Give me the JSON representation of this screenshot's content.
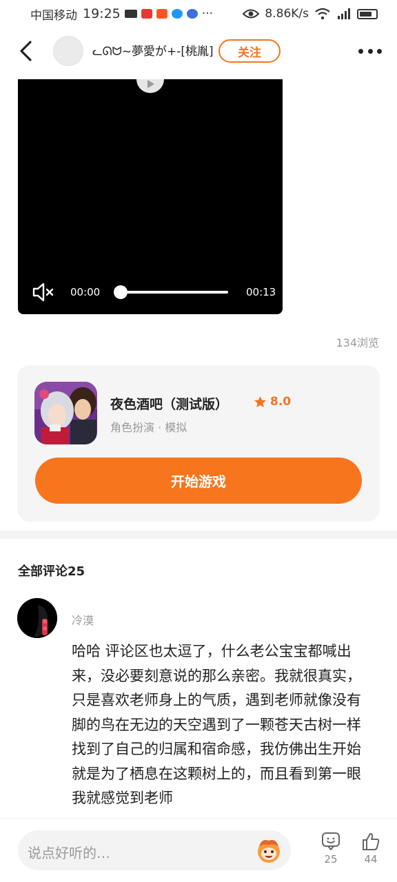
{
  "status_bar": {
    "carrier": "中国移动",
    "time": "19:25",
    "more_indicator": "···",
    "network_speed": "8.86K/s",
    "battery_level_percent": 75
  },
  "header": {
    "author_name": "ᓚᘏᗢ~夢愛が+-[桃胤]",
    "follow_label": "关注"
  },
  "video": {
    "current_time": "00:00",
    "duration": "00:13",
    "progress_percent": 0
  },
  "views_text": "134浏览",
  "game": {
    "title": "夜色酒吧（测试版）",
    "rating": "8.0",
    "tags": "角色扮演 · 模拟",
    "start_label": "开始游戏"
  },
  "comments": {
    "header": "全部评论25",
    "items": [
      {
        "username": "冷漠",
        "text": "哈哈 评论区也太逗了，什么老公宝宝都喊出来，没必要刻意说的那么亲密。我就很真实，只是喜欢老师身上的气质，遇到老师就像没有脚的鸟在无边的天空遇到了一颗苍天古树一样找到了自己的归属和宿命感，我仿佛出生开始就是为了栖息在这颗树上的，而且看到第一眼我就感觉到老师"
      }
    ]
  },
  "bottom_bar": {
    "input_placeholder": "说点好听的…",
    "comment_count": "25",
    "like_count": "44"
  },
  "colors": {
    "accent": "#f7751c",
    "muted": "#999999"
  },
  "icons": [
    "back-arrow-icon",
    "more-dots-icon",
    "play-icon",
    "mute-icon",
    "star-icon",
    "emoji-icon",
    "comment-icon",
    "thumbs-up-icon"
  ]
}
